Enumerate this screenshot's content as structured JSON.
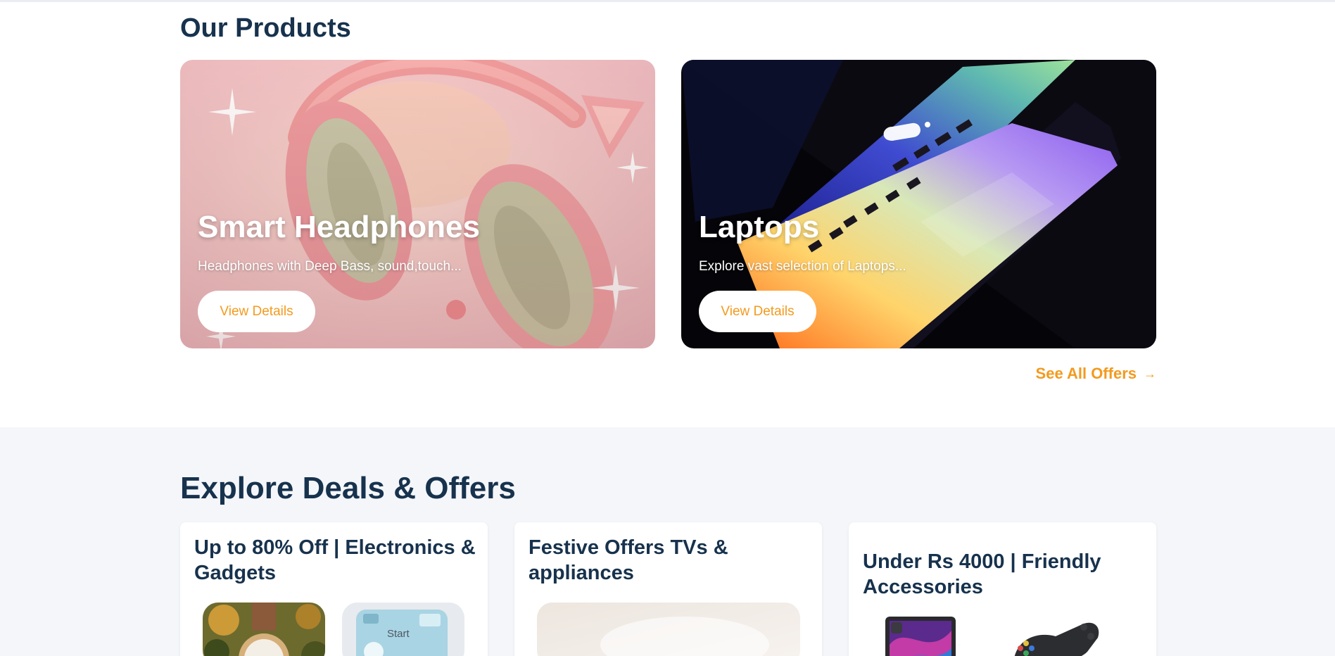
{
  "products": {
    "title": "Our Products",
    "cards": [
      {
        "title": "Smart Headphones",
        "description": "Headphones with Deep Bass, sound,touch...",
        "button": "View Details",
        "image_icon": "headphones-image"
      },
      {
        "title": "Laptops",
        "description": "Explore vast selection of Laptops...",
        "button": "View Details",
        "image_icon": "laptop-image"
      }
    ],
    "see_all": {
      "label": "See All Offers",
      "icon": "arrow-right-icon",
      "arrow_glyph": "→"
    }
  },
  "deals": {
    "title": "Explore Deals & Offers",
    "cards": [
      {
        "title": "Up to 80% Off | Electronics & Gadgets",
        "thumb_text": "Start"
      },
      {
        "title": "Festive Offers TVs & appliances"
      },
      {
        "title": "Under Rs 4000 | Friendly Accessories"
      }
    ]
  },
  "colors": {
    "heading": "#17324d",
    "accent": "#f39a1e",
    "deals_bg": "#f4f6f9",
    "card_bg": "#ffffff"
  }
}
